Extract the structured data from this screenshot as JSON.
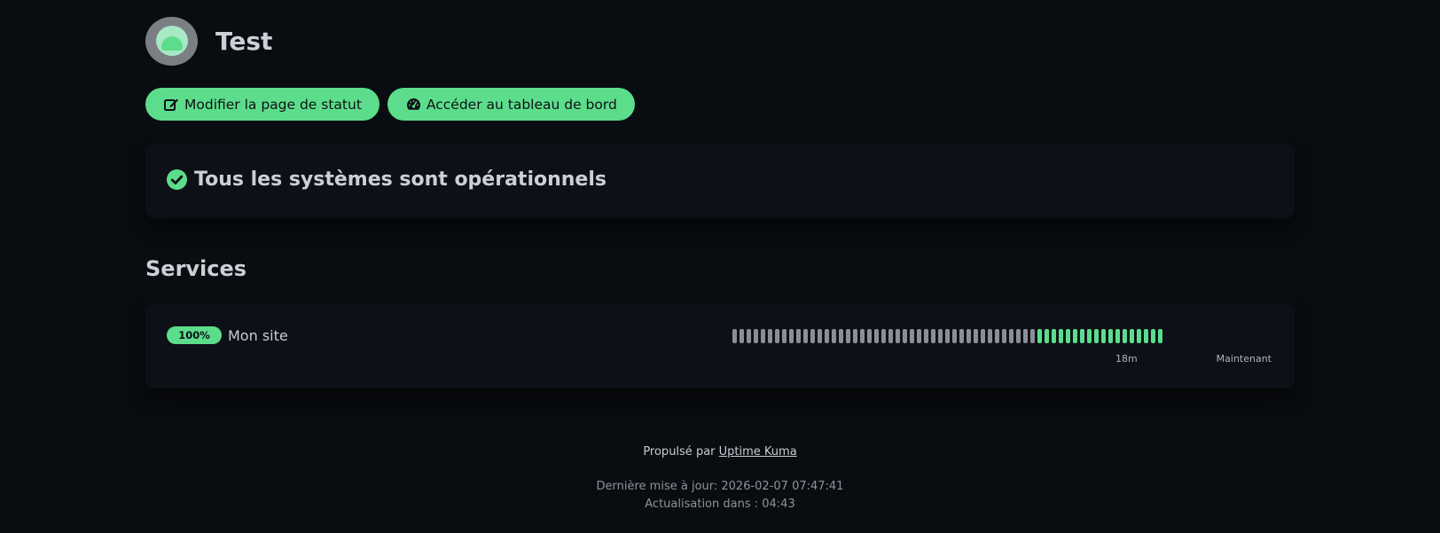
{
  "page": {
    "title": "Test"
  },
  "buttons": {
    "edit_label": "Modifier la page de statut",
    "dashboard_label": "Accéder au tableau de bord"
  },
  "overall_status": {
    "text": "Tous les systèmes sont opérationnels",
    "icon": "check-circle-icon"
  },
  "services_section": {
    "title": "Services",
    "monitors": [
      {
        "uptime": "100%",
        "name": "Mon site",
        "heartbeats": {
          "total": 61,
          "empty": 43,
          "up": 18
        },
        "time_start_label": "18m",
        "time_end_label": "Maintenant"
      }
    ]
  },
  "footer": {
    "powered_by_prefix": "Propulsé par",
    "powered_by_link": "Uptime Kuma",
    "last_updated": "Dernière mise à jour: 2026-02-07 07:47:41",
    "refresh": "Actualisation dans : 04:43"
  },
  "colors": {
    "background": "#090c10",
    "card": "#0d1117",
    "accent": "#5cdd8b",
    "beat_empty": "#8a8f96"
  }
}
